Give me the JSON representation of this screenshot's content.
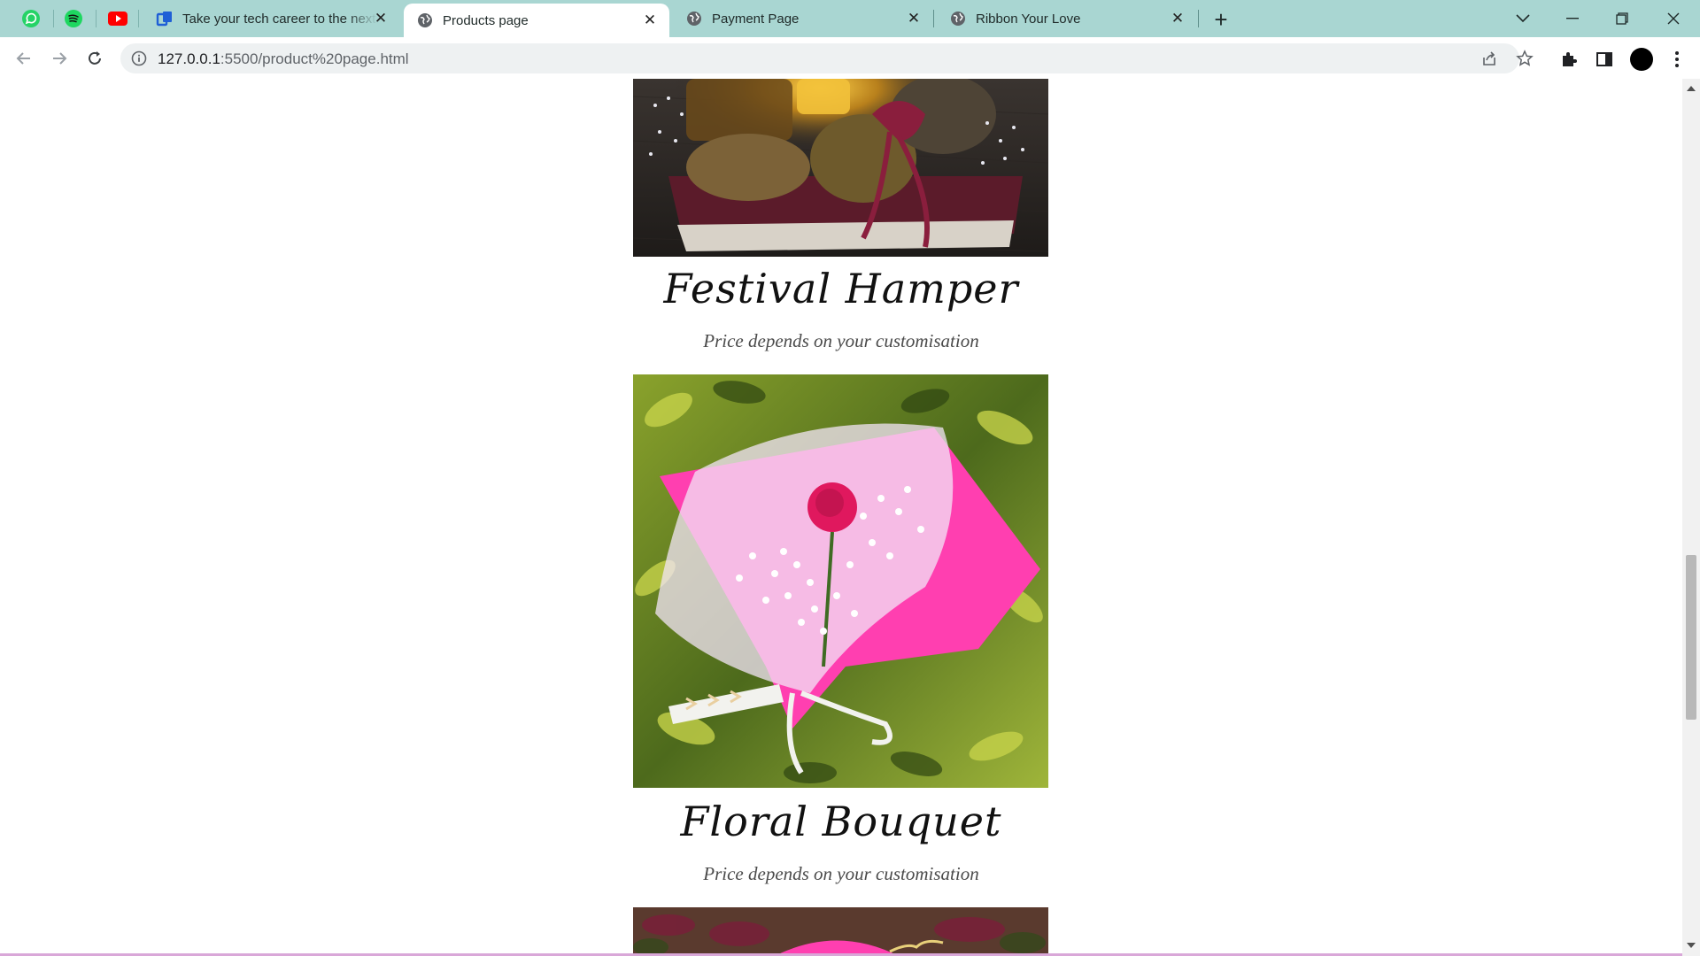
{
  "tabs": [
    {
      "title": "Take your tech career to the next level",
      "icon": "coursera-icon",
      "active": false
    },
    {
      "title": "Products page",
      "icon": "globe-icon",
      "active": true
    },
    {
      "title": "Payment Page",
      "icon": "globe-icon",
      "active": false
    },
    {
      "title": "Ribbon Your Love",
      "icon": "globe-icon",
      "active": false
    }
  ],
  "pinned_tabs": [
    "whatsapp-icon",
    "spotify-icon",
    "youtube-icon"
  ],
  "address_bar": {
    "host": "127.0.0.1",
    "path": ":5500/product%20page.html"
  },
  "products": [
    {
      "name": "Festival Hamper",
      "price": "Price depends on your customisation"
    },
    {
      "name": "Floral Bouquet",
      "price": "Price depends on your customisation"
    }
  ],
  "colors": {
    "tabstrip": "#a9d6d2",
    "bouquet_pink": "#ff3fb0",
    "foliage": "#6c8a2a",
    "hamper_bg": "#2b2622"
  }
}
